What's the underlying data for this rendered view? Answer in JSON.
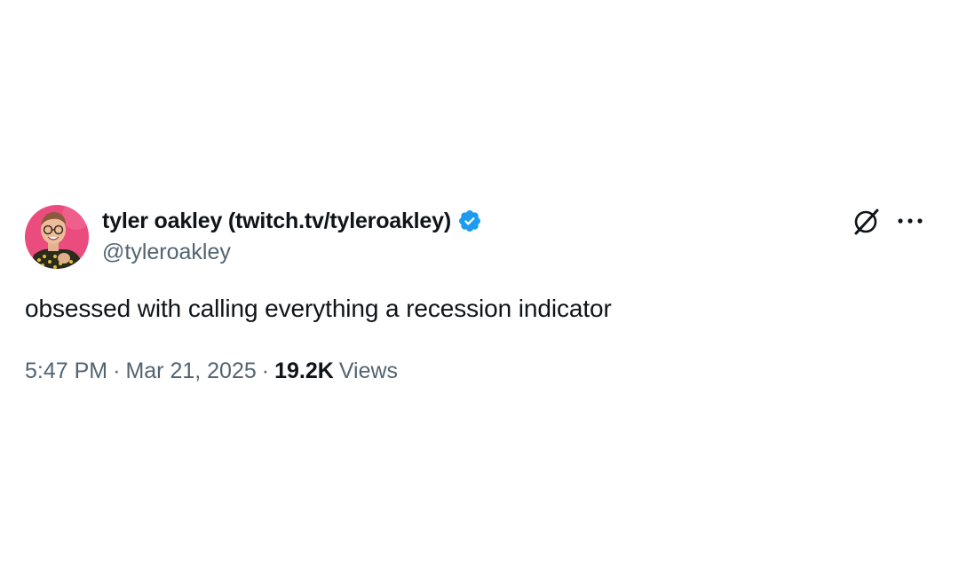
{
  "author": {
    "display_name": "tyler oakley (twitch.tv/tyleroakley)",
    "handle": "@tyleroakley",
    "verified": true,
    "avatar_background": "#e8457a"
  },
  "tweet": {
    "text": "obsessed with calling everything a recession indicator",
    "time": "5:47 PM",
    "date": "Mar 21, 2025",
    "separator": "·",
    "views_count": "19.2K",
    "views_label": "Views"
  },
  "icons": {
    "verified": "verified-badge-icon",
    "grok": "grok-icon",
    "more": "more-options-icon"
  },
  "colors": {
    "text_primary": "#0f1419",
    "text_secondary": "#536471",
    "verified_blue": "#1d9bf0",
    "background": "#ffffff"
  }
}
